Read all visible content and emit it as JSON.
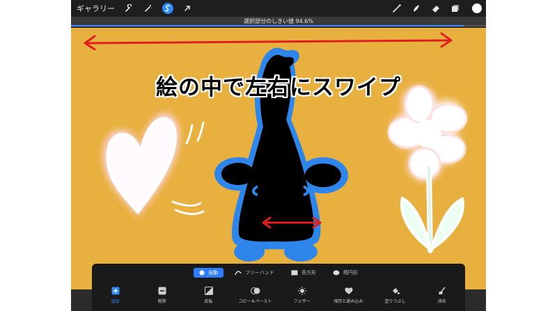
{
  "toolbar": {
    "gallery_label": "ギャラリー",
    "tools": [
      "wrench-icon",
      "magic-wand-icon",
      "selection-icon",
      "transform-arrow-icon"
    ],
    "right_tools": [
      "brush-icon",
      "smudge-icon",
      "eraser-icon",
      "layers-icon"
    ],
    "current_color": "#ffffff"
  },
  "threshold": {
    "label": "選択部分のしきい値 94.6%",
    "value_percent": 94.6
  },
  "canvas": {
    "caption": "絵の中で左右にスワイプ",
    "background_color": "#e8b03e",
    "selection_color": "#2f86ea"
  },
  "selection_modes": [
    {
      "label": "自動",
      "icon": "dot-icon",
      "active": true
    },
    {
      "label": "フリーハンド",
      "icon": "freehand-icon",
      "active": false
    },
    {
      "label": "長方形",
      "icon": "rectangle-icon",
      "active": false
    },
    {
      "label": "楕円形",
      "icon": "ellipse-icon",
      "active": false
    }
  ],
  "actions": [
    {
      "label": "追加",
      "icon": "add-icon",
      "active": true
    },
    {
      "label": "削除",
      "icon": "remove-icon",
      "active": false
    },
    {
      "label": "反転",
      "icon": "invert-icon",
      "active": false
    },
    {
      "label": "コピー＆ペースト",
      "icon": "copy-paste-icon",
      "active": false
    },
    {
      "label": "フェザー",
      "icon": "feather-icon",
      "active": false
    },
    {
      "label": "保存と読み込み",
      "icon": "heart-icon",
      "active": false
    },
    {
      "label": "塗りつぶし",
      "icon": "fill-icon",
      "active": false
    },
    {
      "label": "消去",
      "icon": "clear-icon",
      "active": false
    }
  ]
}
